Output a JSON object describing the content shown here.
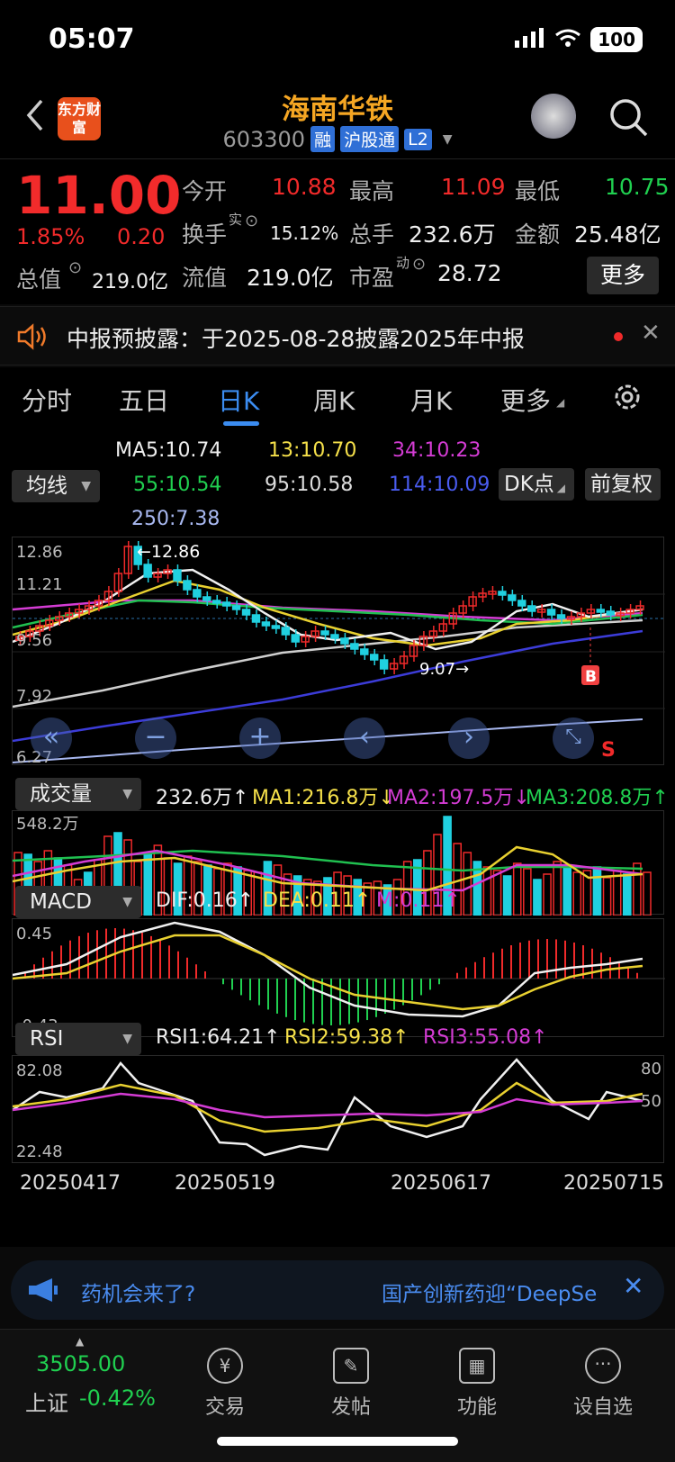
{
  "status": {
    "time": "05:07",
    "battery": "100"
  },
  "header": {
    "logo": "东方财富",
    "stock_name": "海南华铁",
    "code": "603300",
    "tags": [
      "融",
      "沪股通",
      "L2"
    ]
  },
  "quote": {
    "price": "11.00",
    "change_pct": "1.85%",
    "change": "0.20",
    "open_label": "今开",
    "open": "10.88",
    "high_label": "最高",
    "high": "11.09",
    "low_label": "最低",
    "low": "10.75",
    "turnover_label": "换手",
    "turnover_sup": "实",
    "turnover": "15.12%",
    "volume_label": "总手",
    "volume": "232.6万",
    "amount_label": "金额",
    "amount": "25.48亿",
    "total_cap_label": "总值",
    "total_cap": "219.0亿",
    "float_cap_label": "流值",
    "float_cap": "219.0亿",
    "pe_label": "市盈",
    "pe_sup": "动",
    "pe": "28.72",
    "more": "更多"
  },
  "notice": {
    "text": "中报预披露：于2025-08-28披露2025年中报"
  },
  "tabs": [
    "分时",
    "五日",
    "日K",
    "周K",
    "月K",
    "更多"
  ],
  "ma": {
    "selector": "均线",
    "ma5": "MA5:10.74",
    "ma13": "13:10.70",
    "ma34": "34:10.23",
    "ma55": "55:10.54",
    "ma95": "95:10.58",
    "ma114": "114:10.09",
    "ma250": "250:7.38",
    "dk": "DK点",
    "adjust": "前复权"
  },
  "kline": {
    "y_max": "12.86",
    "y_1": "11.21",
    "y_2": "9.56",
    "y_3": "7.92",
    "y_min": "6.27",
    "peak_label": "12.86",
    "trough_label": "9.07",
    "s_mark": "S",
    "b_mark": "B"
  },
  "volume_panel": {
    "selector": "成交量",
    "vol": "232.6万",
    "ma1": "MA1:216.8万",
    "ma2": "MA2:197.5万",
    "ma3": "MA3:208.8万",
    "y_max": "548.2万"
  },
  "macd_panel": {
    "selector": "MACD",
    "dif": "DIF:0.16",
    "dea": "DEA:0.11",
    "m": "M:0.11",
    "y_max": "0.45",
    "y_min": "-0.43"
  },
  "rsi_panel": {
    "selector": "RSI",
    "rsi1": "RSI1:64.21",
    "rsi2": "RSI2:59.38",
    "rsi3": "RSI3:55.08",
    "y_max": "82.08",
    "y_min": "22.48",
    "r80": "80",
    "r50": "50"
  },
  "dates": [
    "20250417",
    "20250519",
    "20250617",
    "20250715"
  ],
  "banner": {
    "left": "药机会来了?",
    "right": "国产创新药迎“DeepSe"
  },
  "bottom_nav": {
    "index_value": "3505.00",
    "index_name": "上证",
    "index_change": "-0.42%",
    "items": [
      "交易",
      "发帖",
      "功能",
      "设自选"
    ]
  },
  "colors": {
    "up": "#f02a2a",
    "down": "#20d0e0",
    "accent": "#3b8cf0",
    "brand": "#f5a623"
  }
}
